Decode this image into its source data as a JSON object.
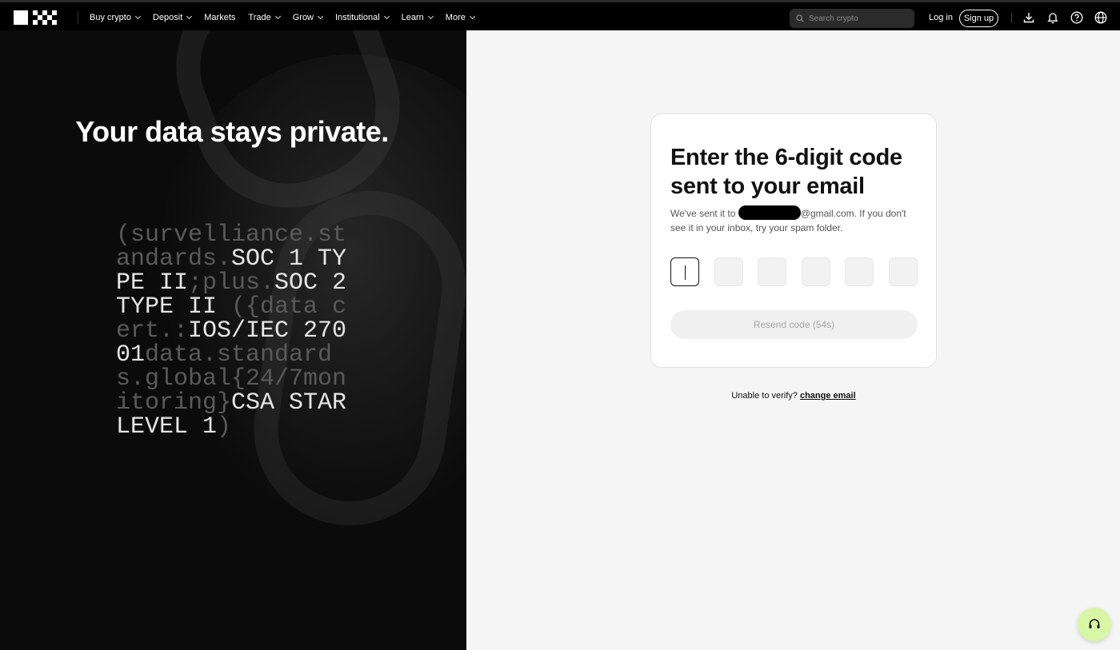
{
  "nav": {
    "items": [
      {
        "label": "Buy crypto",
        "dropdown": true
      },
      {
        "label": "Deposit",
        "dropdown": true
      },
      {
        "label": "Markets",
        "dropdown": false
      },
      {
        "label": "Trade",
        "dropdown": true
      },
      {
        "label": "Grow",
        "dropdown": true
      },
      {
        "label": "Institutional",
        "dropdown": true
      },
      {
        "label": "Learn",
        "dropdown": true
      },
      {
        "label": "More",
        "dropdown": true
      }
    ],
    "search_placeholder": "Search crypto",
    "login_label": "Log in",
    "signup_label": "Sign up",
    "icons": [
      "download-icon",
      "bell-icon",
      "help-icon",
      "globe-icon"
    ]
  },
  "left": {
    "headline": "Your data stays private.",
    "code_segments": [
      {
        "text": "(survelliance.standards.",
        "hi": false
      },
      {
        "text": "SOC 1 TYPE II",
        "hi": true
      },
      {
        "text": ";plus.",
        "hi": false
      },
      {
        "text": "SOC 2 TYPE II",
        "hi": true
      },
      {
        "text": " ({data cert.:",
        "hi": false
      },
      {
        "text": "IOS/IEC 27001",
        "hi": true
      },
      {
        "text": "data.standards.global{24/7monitoring}",
        "hi": false
      },
      {
        "text": "CSA STAR LEVEL 1",
        "hi": true
      },
      {
        "text": ")",
        "hi": false
      }
    ]
  },
  "card": {
    "title": "Enter the 6-digit code sent to your email",
    "desc_before": "We've sent it to ",
    "desc_after": "@gmail.com. If you don't see it in your inbox, try your spam folder.",
    "otp_count": 6,
    "resend_label": "Resend code (54s)"
  },
  "footer": {
    "unable_text": "Unable to verify? ",
    "change_email_label": "change email"
  },
  "colors": {
    "nav_bg": "#000000",
    "left_bg": "#0b0b0b",
    "right_bg": "#f5f5f5",
    "support_bg": "#d7f7a4"
  }
}
